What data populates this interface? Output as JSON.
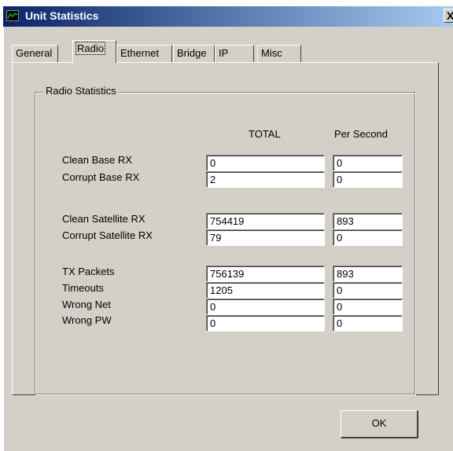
{
  "window": {
    "title": "Unit Statistics",
    "close_label": "X"
  },
  "tabs": [
    "General",
    "Radio",
    "Ethernet",
    "Bridge",
    "IP",
    "Misc"
  ],
  "active_tab": "Radio",
  "group": {
    "title": "Radio Statistics",
    "col_total": "TOTAL",
    "col_per_second": "Per Second",
    "rows": [
      {
        "label": "Clean Base RX",
        "total": "0",
        "per_second": "0"
      },
      {
        "label": "Corrupt Base RX",
        "total": "2",
        "per_second": "0"
      },
      {
        "label": "Clean Satellite RX",
        "total": "754419",
        "per_second": "893"
      },
      {
        "label": "Corrupt Satellite RX",
        "total": "79",
        "per_second": "0"
      },
      {
        "label": "TX Packets",
        "total": "756139",
        "per_second": "893"
      },
      {
        "label": "Timeouts",
        "total": "1205",
        "per_second": "0"
      },
      {
        "label": "Wrong Net",
        "total": "0",
        "per_second": "0"
      },
      {
        "label": "Wrong PW",
        "total": "0",
        "per_second": "0"
      }
    ]
  },
  "ok_label": "OK"
}
